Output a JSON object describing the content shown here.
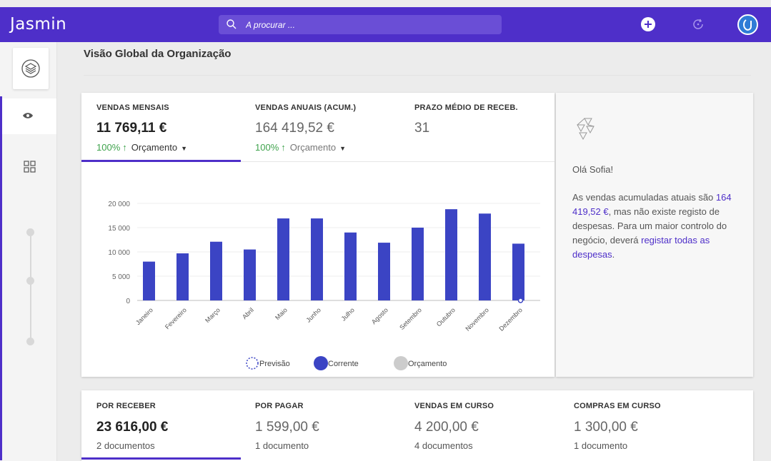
{
  "app": {
    "name": "Jasmin"
  },
  "search": {
    "placeholder": "A procurar ..."
  },
  "page": {
    "title": "Visão Global da Organização"
  },
  "kpis": [
    {
      "label": "VENDAS MENSAIS",
      "value": "11 769,11 €",
      "pct": "100%",
      "budget": "Orçamento"
    },
    {
      "label": "VENDAS ANUAIS (ACUM.)",
      "value": "164 419,52 €",
      "pct": "100%",
      "budget": "Orçamento"
    },
    {
      "label": "PRAZO MÉDIO DE RECEB.",
      "value": "31"
    }
  ],
  "chart_data": {
    "type": "bar",
    "categories": [
      "Janeiro",
      "Fevereiro",
      "Março",
      "Abril",
      "Maio",
      "Junho",
      "Julho",
      "Agosto",
      "Setembro",
      "Outubro",
      "Novembro",
      "Dezembro"
    ],
    "series": [
      {
        "name": "Corrente",
        "values": [
          8000,
          9700,
          12100,
          10500,
          16900,
          16900,
          14000,
          11900,
          15000,
          18800,
          17900,
          11700
        ]
      }
    ],
    "yticks": [
      "20 000",
      "15 000",
      "10 000",
      "5 000",
      "0"
    ],
    "ylim": [
      0,
      20000
    ],
    "legend": [
      "Previsão",
      "Corrente",
      "Orçamento"
    ],
    "legend_position": "bottom",
    "grid": true,
    "colors": {
      "corrente": "#3b44c4",
      "orcamento": "#cccccc",
      "previsao": "#3b44c4"
    }
  },
  "insight": {
    "greeting": "Olá Sofia!",
    "text_1": "As vendas acumuladas atuais são ",
    "amount": "164 419,52 €",
    "text_2": ", mas não existe registo de despesas. Para um maior controlo do negócio, deverá ",
    "link": "registar todas as despesas",
    "text_3": "."
  },
  "bottom": [
    {
      "label": "POR RECEBER",
      "value": "23 616,00 €",
      "sub": "2 documentos"
    },
    {
      "label": "POR PAGAR",
      "value": "1 599,00 €",
      "sub": "1 documento"
    },
    {
      "label": "VENDAS EM CURSO",
      "value": "4 200,00 €",
      "sub": "4 documentos"
    },
    {
      "label": "COMPRAS EM CURSO",
      "value": "1 300,00 €",
      "sub": "1 documento"
    }
  ],
  "icons": [
    "search-icon",
    "plus-icon",
    "refresh-icon",
    "avatar",
    "layers-icon",
    "eye-icon",
    "grid-icon"
  ],
  "colors": {
    "brand": "#4e2fc9",
    "positive": "#3fa34d"
  }
}
